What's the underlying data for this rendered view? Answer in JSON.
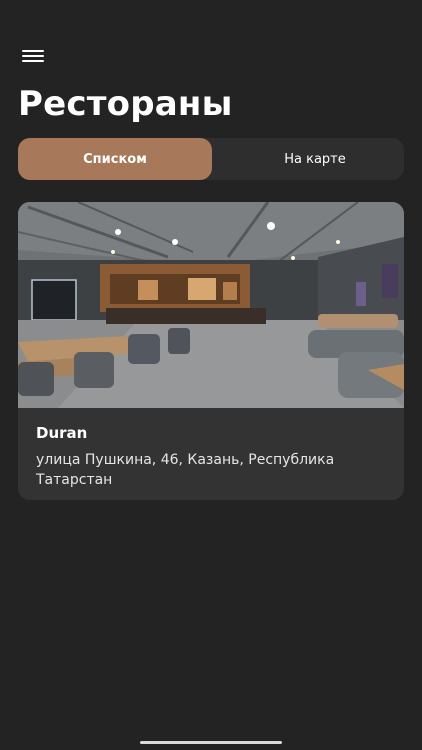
{
  "header": {
    "menu_icon": "hamburger-menu-icon",
    "title": "Рестораны"
  },
  "view_toggle": {
    "options": [
      {
        "label": "Списком",
        "active": true
      },
      {
        "label": "На карте",
        "active": false
      }
    ]
  },
  "restaurants": [
    {
      "name": "Duran",
      "address": "улица Пушкина, 46, Казань, Республика Татарстан"
    }
  ],
  "colors": {
    "background": "#232323",
    "accent": "#a8785a",
    "card": "#333333",
    "segment_bg": "#2e2e2e"
  }
}
